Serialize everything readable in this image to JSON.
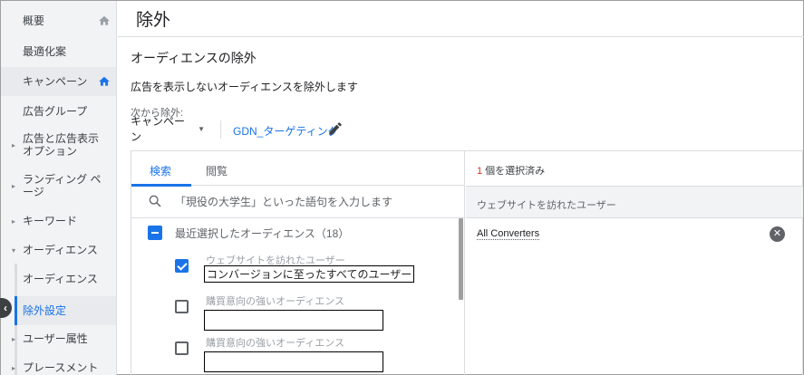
{
  "sidebar": {
    "items": [
      {
        "label": "概要",
        "has_home": true
      },
      {
        "label": "最適化案"
      },
      {
        "label": "キャンペーン",
        "has_home": true,
        "home_color": "#1a73e8"
      },
      {
        "label": "広告グループ"
      },
      {
        "label": "広告と広告表示オプション"
      },
      {
        "label": "ランディング ページ"
      },
      {
        "label": "キーワード"
      },
      {
        "label": "オーディエンス"
      },
      {
        "label": "オーディエンス"
      },
      {
        "label": "除外設定"
      },
      {
        "label": "ユーザー属性"
      },
      {
        "label": "プレースメント"
      }
    ],
    "collapse_icon": "‹"
  },
  "header": {
    "title": "除外"
  },
  "section": {
    "title": "オーディエンスの除外",
    "description": "広告を表示しないオーディエンスを除外します",
    "exclude_from_label": "次から除外:",
    "level_value": "キャンペーン",
    "campaign_name": "GDN_ターゲティング"
  },
  "tabs": [
    {
      "label": "検索"
    },
    {
      "label": "閲覧"
    }
  ],
  "search": {
    "placeholder": "「現役の大学生」といった語句を入力します"
  },
  "group": {
    "label": "最近選択したオーディエンス（18）"
  },
  "audiences": [
    {
      "category": "ウェブサイトを訪れたユーザー",
      "name": "コンバージョンに至ったすべてのユーザー",
      "checked": true
    },
    {
      "category": "購買意向の強いオーディエンス",
      "name": "",
      "checked": false
    },
    {
      "category": "購買意向の強いオーディエンス",
      "name": "",
      "checked": false
    }
  ],
  "selected": {
    "count": "1",
    "count_suffix": " 個を選択済み",
    "header": "ウェブサイトを訪れたユーザー",
    "items": [
      {
        "label": "All Converters"
      }
    ]
  },
  "colors": {
    "accent": "#1a73e8",
    "count_num": "#d93025"
  }
}
